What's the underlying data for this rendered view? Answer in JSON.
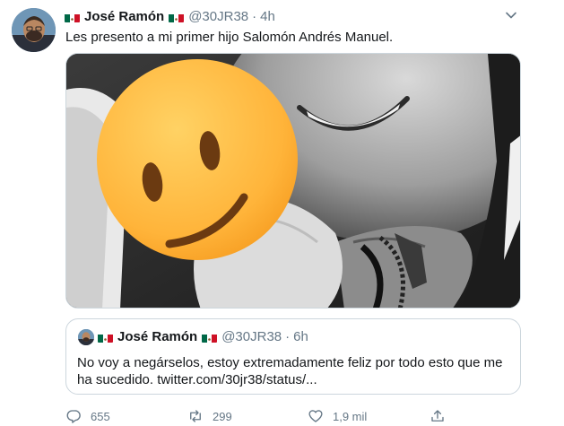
{
  "tweet": {
    "author_name": "José Ramón",
    "handle": "@30JR38",
    "separator": "·",
    "time": "4h",
    "text": "Les presento a mi primer hijo Salomón Andrés Manuel."
  },
  "quoted_tweet": {
    "author_name": "José Ramón",
    "handle": "@30JR38",
    "separator": "·",
    "time": "6h",
    "text": "No voy a negárselos, estoy extremadamente feliz por todo esto que me ha sucedido. twitter.com/30jr38/status/..."
  },
  "actions": {
    "replies": "655",
    "retweets": "299",
    "likes": "1,9 mil"
  },
  "icons": {
    "flag": "mexico-flag-icon",
    "menu": "chevron-down-icon",
    "reply": "reply-icon",
    "retweet": "retweet-icon",
    "like": "heart-icon",
    "share": "share-icon",
    "media_overlay": "slightly-smiling-face-emoji"
  },
  "colors": {
    "secondary_text": "#657786",
    "border": "#ccd6dd",
    "emoji_fill": "#ffb43a"
  }
}
